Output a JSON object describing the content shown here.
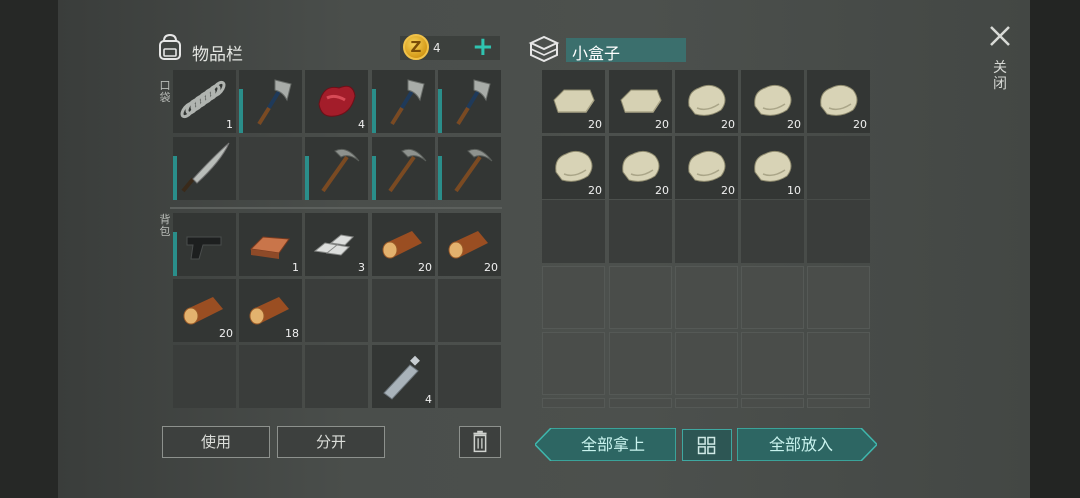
{
  "inventory": {
    "title": "物品栏",
    "coins": "4",
    "pocket_label": "口袋",
    "backpack_label": "背包",
    "pocket_slots": [
      {
        "item": "spring-coil",
        "count": "1"
      },
      {
        "item": "hatchet",
        "count": ""
      },
      {
        "item": "raw-meat",
        "count": "4"
      },
      {
        "item": "hatchet",
        "count": ""
      },
      {
        "item": "hatchet",
        "count": ""
      },
      {
        "item": "machete",
        "count": ""
      },
      {
        "item": "empty",
        "count": ""
      },
      {
        "item": "pickaxe",
        "count": ""
      },
      {
        "item": "pickaxe",
        "count": ""
      },
      {
        "item": "pickaxe",
        "count": ""
      }
    ],
    "backpack_slots": [
      {
        "item": "pistol",
        "count": ""
      },
      {
        "item": "copper-ingot",
        "count": "1"
      },
      {
        "item": "iron-ingots",
        "count": "3"
      },
      {
        "item": "log",
        "count": "20"
      },
      {
        "item": "log",
        "count": "20"
      },
      {
        "item": "log",
        "count": "20"
      },
      {
        "item": "log",
        "count": "18"
      },
      {
        "item": "empty",
        "count": ""
      },
      {
        "item": "empty",
        "count": ""
      },
      {
        "item": "empty",
        "count": ""
      },
      {
        "item": "empty",
        "count": ""
      },
      {
        "item": "empty",
        "count": ""
      },
      {
        "item": "empty",
        "count": ""
      },
      {
        "item": "water-bottle",
        "count": "4"
      },
      {
        "item": "empty",
        "count": ""
      }
    ]
  },
  "container": {
    "title": "小盒子",
    "slots": [
      {
        "item": "stone-block",
        "count": "20"
      },
      {
        "item": "stone-block",
        "count": "20"
      },
      {
        "item": "stone",
        "count": "20"
      },
      {
        "item": "stone",
        "count": "20"
      },
      {
        "item": "stone",
        "count": "20"
      },
      {
        "item": "stone",
        "count": "20"
      },
      {
        "item": "stone",
        "count": "20"
      },
      {
        "item": "stone",
        "count": "20"
      },
      {
        "item": "stone",
        "count": "10"
      }
    ]
  },
  "buttons": {
    "use": "使用",
    "split": "分开",
    "take_all": "全部拿上",
    "put_all": "全部放入",
    "close": "关闭"
  },
  "colors": {
    "accent_teal": "#2fc3b0",
    "durability_bar": "#2a8e8a"
  }
}
